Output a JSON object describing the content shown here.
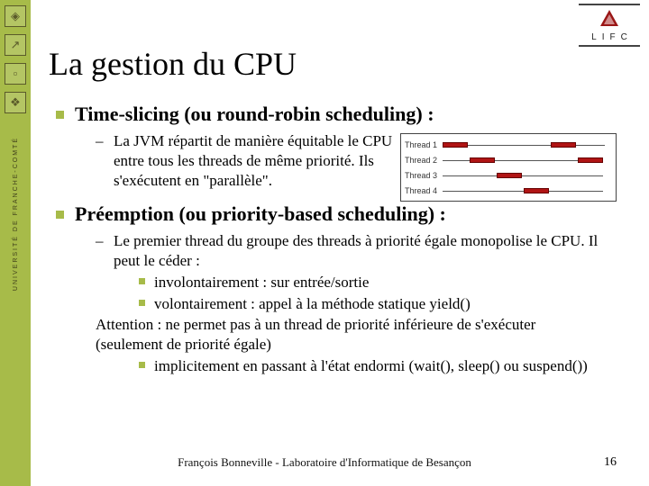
{
  "sidebar": {
    "vertical_label": "UNIVERSITÉ DE FRANCHE-COMTÉ"
  },
  "logo": {
    "letters": "LIFC"
  },
  "title": "La gestion du CPU",
  "section1": {
    "heading": "Time-slicing (ou round-robin scheduling) :",
    "sub": "La JVM répartit de manière équitable le CPU entre tous les threads de même priorité. Ils s'exécutent en \"parallèle\"."
  },
  "diagram": {
    "rows": [
      "Thread 1",
      "Thread 2",
      "Thread 3",
      "Thread 4"
    ]
  },
  "section2": {
    "heading": "Préemption (ou priority-based scheduling) :",
    "sub1_a": "Le premier thread du groupe des threads à priorité égale monopolise le CPU. Il peut le céder :",
    "b1": "involontairement : sur entrée/sortie",
    "b2": "volontairement : appel à la méthode statique yield()",
    "warn": " Attention : ne permet pas à un thread de priorité inférieure de s'exécuter (seulement de priorité égale)",
    "b3": "implicitement en passant à l'état endormi (wait(), sleep() ou suspend())"
  },
  "footer": "François Bonneville - Laboratoire d'Informatique de Besançon",
  "page_number": "16"
}
